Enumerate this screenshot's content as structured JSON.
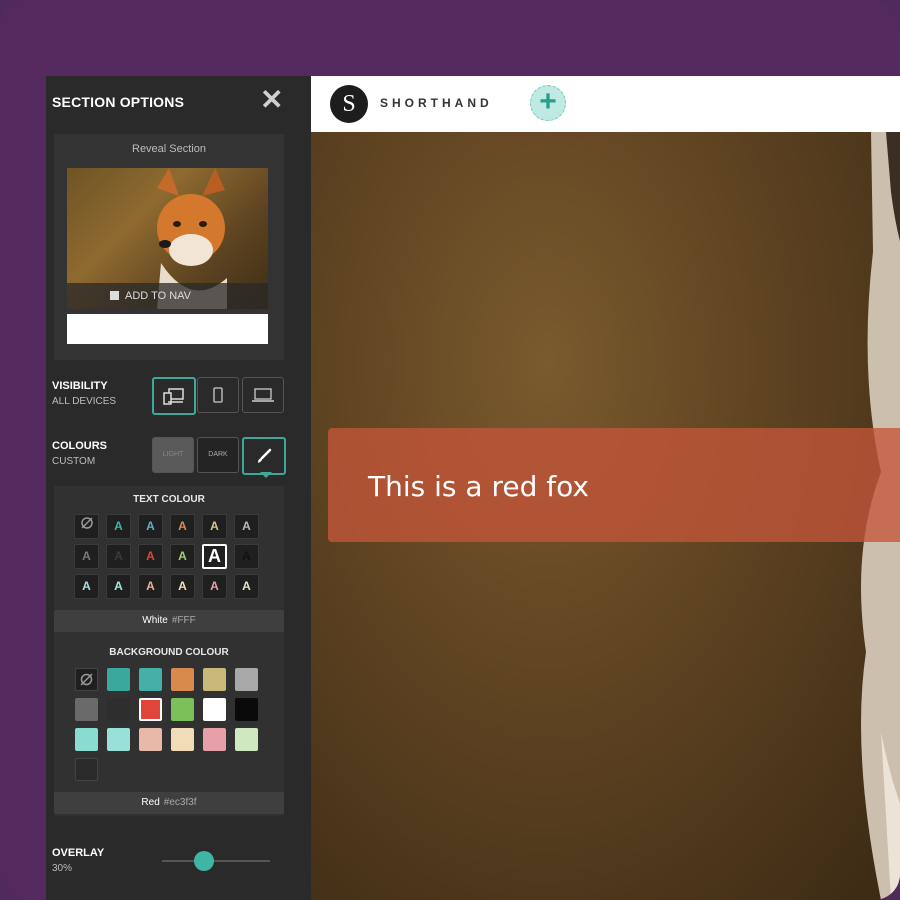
{
  "panel": {
    "title": "SECTION OPTIONS",
    "close_glyph": "✕",
    "reveal_label": "Reveal Section",
    "add_to_nav": "ADD TO NAV",
    "nav_input_value": "",
    "visibility": {
      "label": "VISIBILITY",
      "value": "ALL DEVICES"
    },
    "colours": {
      "label": "COLOURS",
      "value": "CUSTOM",
      "light": "LIGHT",
      "dark": "DARK"
    },
    "text_colour": {
      "title": "TEXT COLOUR",
      "selected_name": "White",
      "selected_hex": "#FFF",
      "swatches": [
        [
          "none",
          "#3fb5a6",
          "#5fb0c8",
          "#e08a4e",
          "#d8c68a",
          "#b8b8b8"
        ],
        [
          "#7a7a7a",
          "#3a3a3a",
          "#e0453a",
          "#a0d070",
          "#ffffff",
          "#111111"
        ],
        [
          "#a8e0e0",
          "#a8e8e0",
          "#e8b0a0",
          "#f0e0c0",
          "#e8a0a8",
          "#d8e8c8"
        ]
      ]
    },
    "background_colour": {
      "title": "BACKGROUND COLOUR",
      "selected_name": "Red",
      "selected_hex": "#ec3f3f",
      "swatches": [
        [
          "none",
          "#3aa89a",
          "#45b0a8",
          "#d88a4c",
          "#c8b87a",
          "#a8a8a8"
        ],
        [
          "#6a6a6a",
          "#2e2e2e",
          "#e0453a",
          "#7cc05a",
          "#ffffff",
          "#0a0a0a"
        ],
        [
          "#88dcd0",
          "#98e0d8",
          "#e8b8a8",
          "#f0ddb8",
          "#e8a0a8",
          "#d0e8c0"
        ],
        [
          "empty"
        ]
      ]
    },
    "overlay": {
      "label": "OVERLAY",
      "value": "30%",
      "level": 0.3
    }
  },
  "topbar": {
    "logo_letter": "S",
    "brand": "SHORTHAND",
    "add_glyph": "+"
  },
  "canvas": {
    "title_text": "This is a red fox"
  },
  "colors": {
    "accent": "#3fa89a",
    "frame": "#54295e",
    "banner": "#c4563a"
  }
}
